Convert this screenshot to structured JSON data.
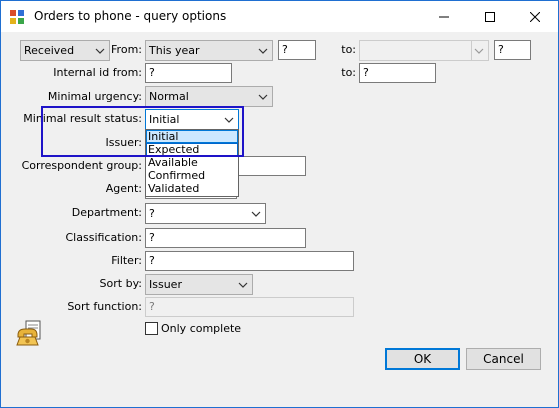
{
  "window": {
    "title": "Orders to phone - query options"
  },
  "header_row": {
    "date_type": "Received",
    "from_label": "From:",
    "from_value": "This year",
    "from_extra": "?",
    "to_label": "to:",
    "to_value": "",
    "to_extra": "?"
  },
  "fields": {
    "internal_id_label": "Internal id from:",
    "internal_id_value": "?",
    "internal_id_to_label": "to:",
    "internal_id_to_value": "?",
    "min_urgency_label": "Minimal urgency:",
    "min_urgency_value": "Normal",
    "min_result_label": "Minimal result status:",
    "min_result_value": "Initial",
    "issuer_label": "Issuer:",
    "correspondent_label": "Correspondent group:",
    "agent_label": "Agent:",
    "department_label": "Department:",
    "department_value": "?",
    "classification_label": "Classification:",
    "classification_value": "?",
    "filter_label": "Filter:",
    "filter_value": "?",
    "sort_by_label": "Sort by:",
    "sort_by_value": "Issuer",
    "sort_function_label": "Sort function:",
    "sort_function_value": "?",
    "only_complete_label": "Only complete"
  },
  "result_status_options": [
    "Initial",
    "Expected",
    "Available",
    "Confirmed",
    "Validated"
  ],
  "buttons": {
    "ok": "OK",
    "cancel": "Cancel"
  },
  "colors": {
    "highlight": "#1e13c8",
    "accent": "#0078d7"
  }
}
